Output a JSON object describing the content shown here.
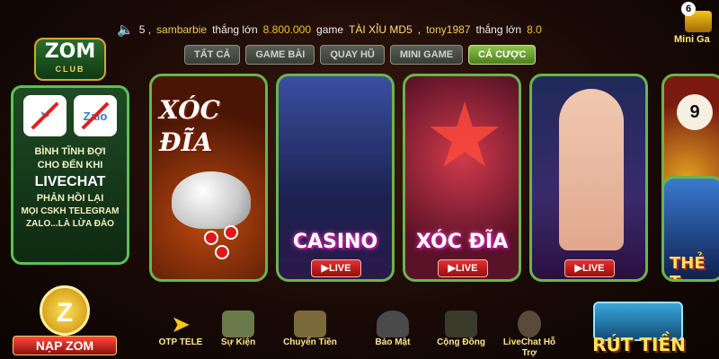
{
  "ticker": {
    "pre": "5 ,",
    "user1": "sambarbie",
    "text1": "thắng lớn",
    "amount1": "8.800.000",
    "text2": "game",
    "game1": "TÀI XỈU MD5",
    "sep": ",",
    "user2": "tony1987",
    "text3": "thắng lớn",
    "amount2": "8.0"
  },
  "logo": {
    "name": "ZOM",
    "sub": "CLUB"
  },
  "mini_game": {
    "badge": "6",
    "label": "Mini Ga"
  },
  "tabs": [
    {
      "label": "TẤT CẢ"
    },
    {
      "label": "GAME BÀI"
    },
    {
      "label": "QUAY HŨ"
    },
    {
      "label": "MINI GAME"
    },
    {
      "label": "CÁ CƯỢC"
    }
  ],
  "warning": {
    "icon2": "Zalo",
    "line1": "BÌNH TĨNH ĐỢI",
    "line2": "CHO ĐẾN KHI",
    "line3": "LIVECHAT",
    "line4": "PHẢN HỒI LẠI",
    "line5": "MỌI CSKH TELEGRAM",
    "line6": "ZALO...LÀ LỪA ĐẢO"
  },
  "cards": {
    "c1_line1": "XÓC",
    "c1_line2": "ĐĨA",
    "c2_title": "CASINO",
    "c3_title": "XÓC ĐĨA",
    "live": "▶LIVE",
    "c5_ball": "9",
    "c6_title": "THẺ T"
  },
  "bottom": {
    "nap_coin": "Z",
    "nap_label": "NẠP ZOM",
    "items": [
      {
        "label": "OTP TELE"
      },
      {
        "label": "Sự Kiện"
      },
      {
        "label": "Chuyển Tiền"
      },
      {
        "label": "Bảo Mật"
      },
      {
        "label": "Cộng Đồng"
      },
      {
        "label": "LiveChat Hỗ Trợ"
      }
    ],
    "rut_label": "RÚT TIỀN"
  },
  "colors": {
    "accent_green": "#6ab44a",
    "gold": "#f5c518",
    "live_red": "#e23030"
  }
}
